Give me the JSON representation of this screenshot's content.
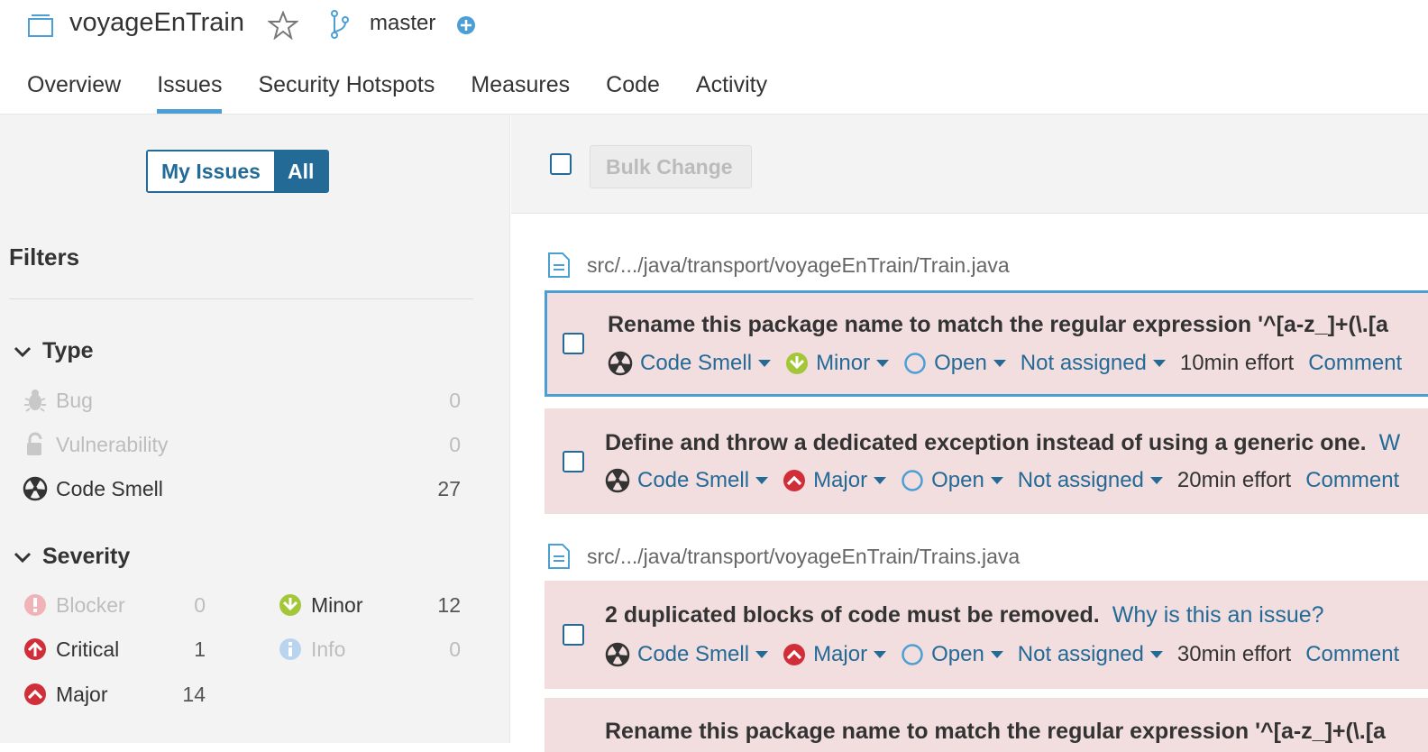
{
  "header": {
    "project_name": "voyageEnTrain",
    "branch": "master"
  },
  "tabs": [
    "Overview",
    "Issues",
    "Security Hotspots",
    "Measures",
    "Code",
    "Activity"
  ],
  "active_tab": "Issues",
  "sidebar": {
    "toggle": {
      "mine": "My Issues",
      "all": "All"
    },
    "filters_title": "Filters",
    "type_facet": {
      "title": "Type",
      "items": [
        {
          "label": "Bug",
          "count": "0",
          "icon": "bug-icon"
        },
        {
          "label": "Vulnerability",
          "count": "0",
          "icon": "lock-icon"
        },
        {
          "label": "Code Smell",
          "count": "27",
          "icon": "code-smell-icon"
        }
      ]
    },
    "severity_facet": {
      "title": "Severity",
      "items": [
        {
          "label": "Blocker",
          "count": "0",
          "icon": "blocker-icon"
        },
        {
          "label": "Minor",
          "count": "12",
          "icon": "minor-icon"
        },
        {
          "label": "Critical",
          "count": "1",
          "icon": "critical-icon"
        },
        {
          "label": "Info",
          "count": "0",
          "icon": "info-icon"
        },
        {
          "label": "Major",
          "count": "14",
          "icon": "major-icon"
        }
      ]
    }
  },
  "bulk": {
    "button": "Bulk Change"
  },
  "files": [
    "src/.../java/transport/voyageEnTrain/Train.java",
    "src/.../java/transport/voyageEnTrain/Trains.java"
  ],
  "issues": [
    {
      "message": "Rename this package name to match the regular expression '^[a-z_]+(\\.[a",
      "why": "",
      "type": "Code Smell",
      "severity": "Minor",
      "status": "Open",
      "assignee": "Not assigned",
      "effort": "10min effort",
      "comment": "Comment"
    },
    {
      "message": "Define and throw a dedicated exception instead of using a generic one.",
      "why": "W",
      "type": "Code Smell",
      "severity": "Major",
      "status": "Open",
      "assignee": "Not assigned",
      "effort": "20min effort",
      "comment": "Comment"
    },
    {
      "message": "2 duplicated blocks of code must be removed.",
      "why": "Why is this an issue?",
      "type": "Code Smell",
      "severity": "Major",
      "status": "Open",
      "assignee": "Not assigned",
      "effort": "30min effort",
      "comment": "Comment"
    },
    {
      "message": "Rename this package name to match the regular expression '^[a-z_]+(\\.[a"
    }
  ],
  "colors": {
    "accent": "#236a97",
    "tab_underline": "#4b9fd5",
    "issue_bg": "#f2dede",
    "minor_green": "#a4c639",
    "major_red": "#d02f3a"
  }
}
